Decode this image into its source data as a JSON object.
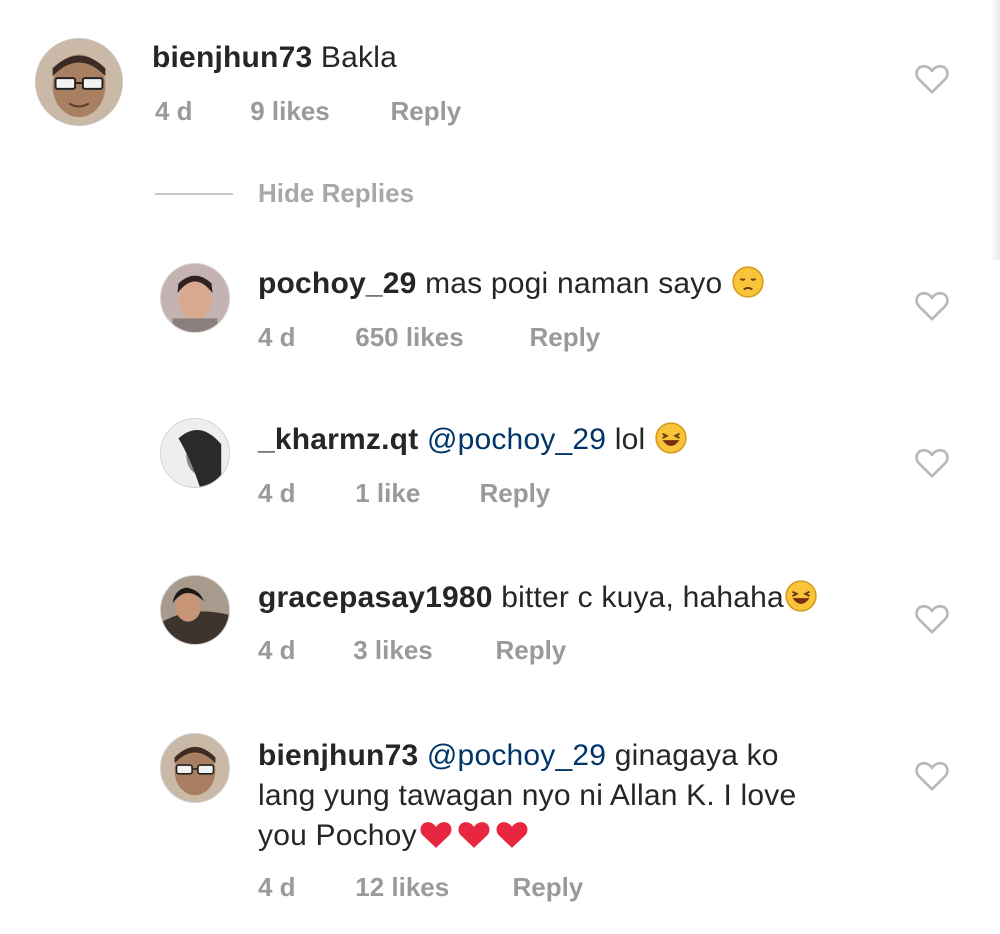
{
  "main_comment": {
    "username": "bienjhun73",
    "text": "Bakla",
    "age": "4 d",
    "likes": "9 likes",
    "reply_label": "Reply"
  },
  "hide_replies_label": "Hide Replies",
  "replies": [
    {
      "username": "pochoy_29",
      "text": "mas pogi naman sayo",
      "emoji": "pensive-face-emoji",
      "age": "4 d",
      "likes": "650 likes",
      "reply_label": "Reply"
    },
    {
      "username": "_kharmz.qt",
      "mention": "@pochoy_29",
      "text": "lol",
      "emoji": "laughing-face-emoji",
      "age": "4 d",
      "likes": "1 like",
      "reply_label": "Reply"
    },
    {
      "username": "gracepasay1980",
      "text": "bitter c kuya, hahaha",
      "emoji": "laughing-face-emoji",
      "age": "4 d",
      "likes": "3 likes",
      "reply_label": "Reply"
    },
    {
      "username": "bienjhun73",
      "mention": "@pochoy_29",
      "text_line1": "ginagaya ko",
      "text_line2": "lang yung tawagan nyo ni Allan K. I love",
      "text_line3": "you Pochoy",
      "emoji": "red-heart-emoji x3",
      "age": "4 d",
      "likes": "12 likes",
      "reply_label": "Reply"
    }
  ],
  "colors": {
    "username": "#262626",
    "mention": "#003569",
    "meta": "#9a9a9a",
    "heart_outline": "#b8b8b8",
    "red_heart": "#e8263f"
  }
}
